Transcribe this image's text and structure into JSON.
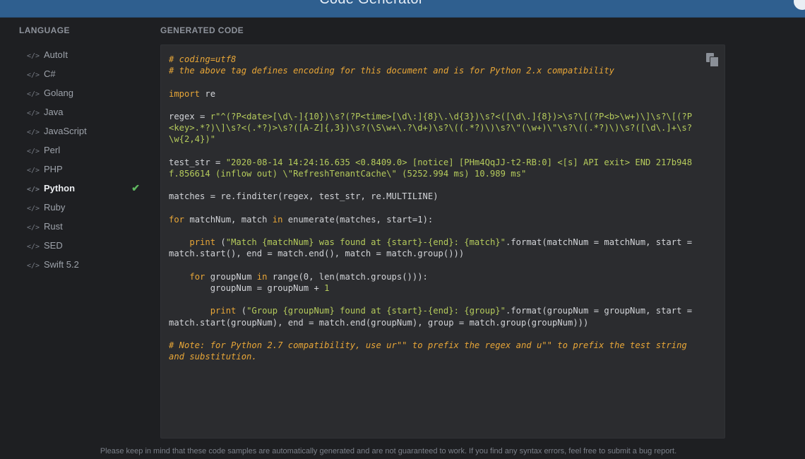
{
  "window": {
    "title": "Code Generator"
  },
  "sidebar": {
    "header": "LANGUAGE",
    "items": [
      {
        "label": "AutoIt"
      },
      {
        "label": "C#"
      },
      {
        "label": "Golang"
      },
      {
        "label": "Java"
      },
      {
        "label": "JavaScript"
      },
      {
        "label": "Perl"
      },
      {
        "label": "PHP"
      },
      {
        "label": "Python",
        "selected": true
      },
      {
        "label": "Ruby"
      },
      {
        "label": "Rust"
      },
      {
        "label": "SED"
      },
      {
        "label": "Swift 5.2"
      }
    ],
    "icon_glyph": "</>",
    "check_glyph": "✔"
  },
  "main": {
    "header": "GENERATED CODE",
    "code": {
      "comment1": "# coding=utf8",
      "comment2": "# the above tag defines encoding for this document and is for Python 2.x compatibility",
      "import_kw": "import",
      "import_rest": " re",
      "regex_var": "regex = ",
      "regex_str_1": "r\"^(?P<date>[\\d\\-]{10})\\s?(?P<time>[\\d\\:]{8}\\.\\d{3})\\s?<([\\d\\.]{8})>\\s?\\[(?P<b>\\w+)\\]\\s?\\[(?P",
      "regex_str_2": "<key>.*?)\\]\\s?<(.*?)>\\s?([A-Z]{,3})\\s?(\\S\\w+\\.?\\d+)\\s?\\((.*?)\\)\\s?\\\"(\\w+)\\\"\\s?\\((.*?)\\)\\s?([\\d\\.]+\\s?",
      "regex_str_3": "\\w{2,4})\"",
      "test_var": "test_str = ",
      "test_str_1": "\"2020-08-14 14:24:16.635 <0.8409.0> [notice] [PHm4QqJJ-t2-RB:0] <[s] API exit> END 217b948",
      "test_str_2": "f.856614 (inflow out) \\\"RefreshTenantCache\\\" (5252.994 ms) 10.989 ms\"",
      "matches_line": "matches = re.finditer(regex, test_str, re.MULTILINE)",
      "for_kw": "for",
      "for_mid": " matchNum, match ",
      "in_kw": "in",
      "for_rest": " enumerate(matches, start=1):",
      "print_kw_1": "print",
      "print1_str": "\"Match {matchNum} was found at {start}-{end}: {match}\"",
      "print1_rest": ".format(matchNum = matchNum, start =",
      "print1_line2": "match.start(), end = match.end(), match = match.group()))",
      "for2_kw": "for",
      "for2_mid": " groupNum ",
      "in2_kw": "in",
      "for2_rest": " range(0, len(match.groups())):",
      "group_assign": "groupNum = groupNum + ",
      "group_one": "1",
      "print_kw_2": "print",
      "print2_str": "\"Group {groupNum} found at {start}-{end}: {group}\"",
      "print2_rest": ".format(groupNum = groupNum, start =",
      "print2_line2": "match.start(groupNum), end = match.end(groupNum), group = match.group(groupNum)))",
      "note_1": "# Note: for Python 2.7 compatibility, use ur\"\" to prefix the regex and u\"\" to prefix the test string",
      "note_2": "and substitution."
    }
  },
  "footer": {
    "text": "Please keep in mind that these code samples are automatically generated and are not guaranteed to work. If you find any syntax errors, feel free to submit a bug report."
  },
  "colors": {
    "accent_bar": "#2f5f8f",
    "check": "#5fb65f",
    "comment": "#e8a637",
    "string": "#b5cb5c"
  }
}
